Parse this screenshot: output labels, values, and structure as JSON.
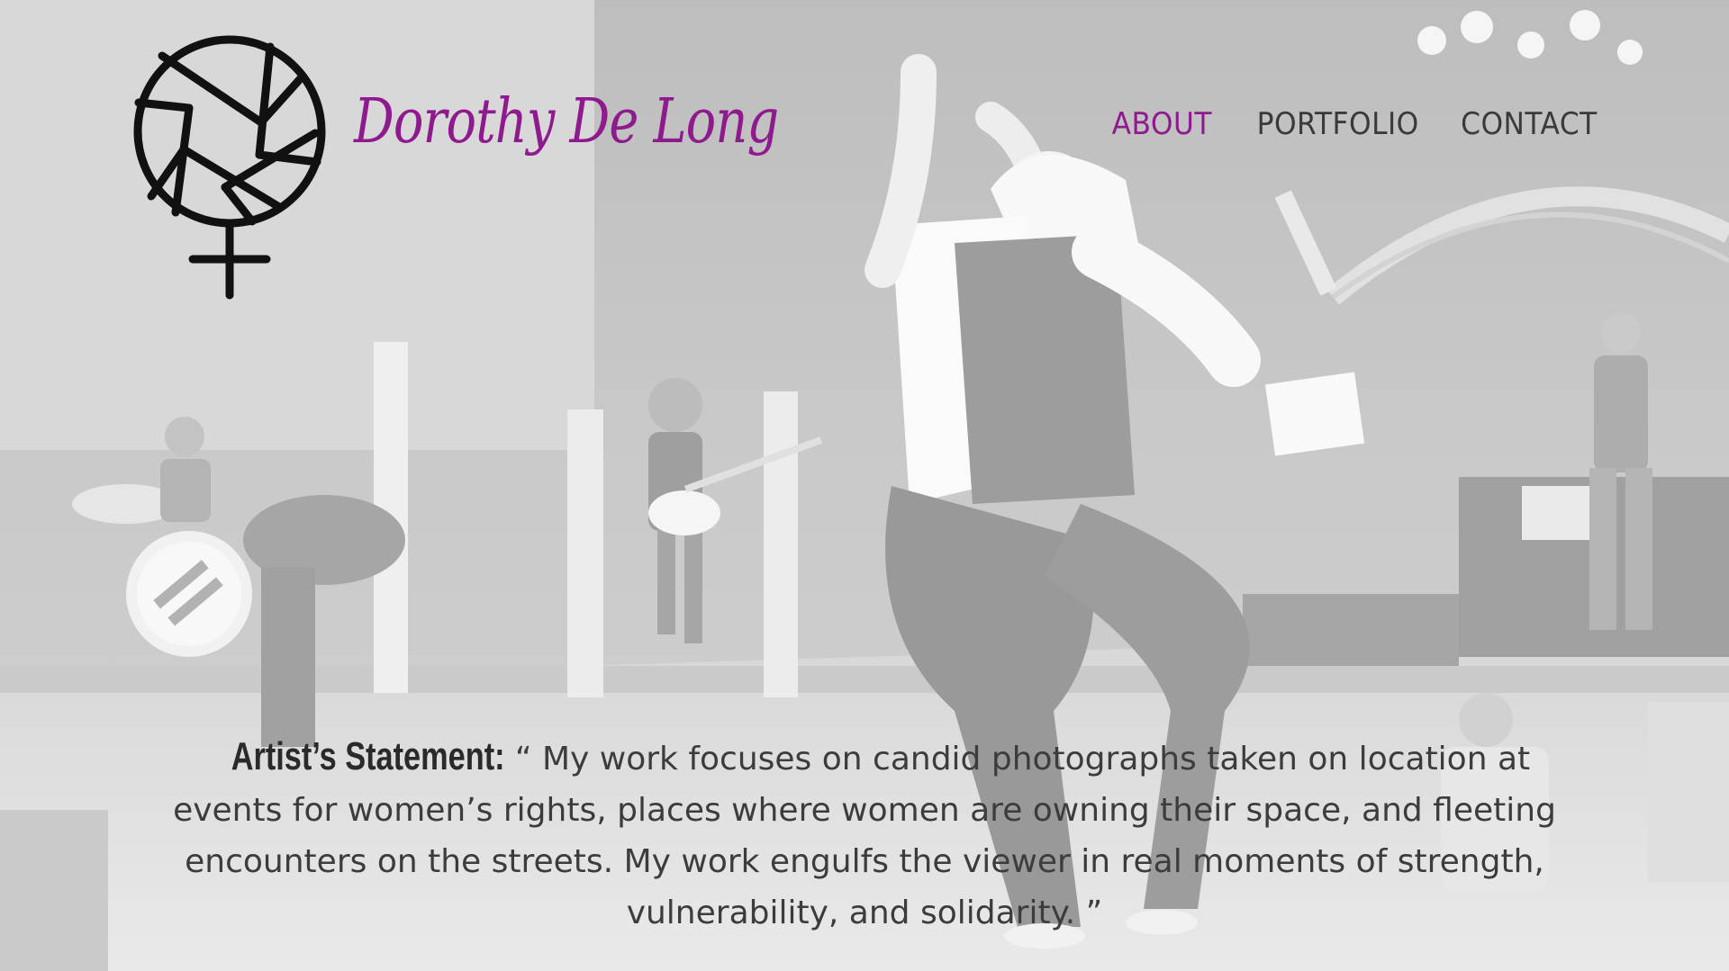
{
  "site": {
    "brand_name": "Dorothy De Long",
    "logo_icon": "aperture-female-symbol-icon"
  },
  "nav": {
    "items": [
      {
        "label": "ABOUT",
        "active": true
      },
      {
        "label": "PORTFOLIO",
        "active": false
      },
      {
        "label": "CONTACT",
        "active": false
      }
    ]
  },
  "statement": {
    "label": "Artist’s Statement:",
    "text": "“ My work focuses on candid photographs taken on location at events for women’s rights, places where women are owning their space, and fleeting encounters on the streets. My work engulfs the viewer in real moments of strength, vulnerability, and solidarity. ”"
  },
  "colors": {
    "accent": "#8e1a8e",
    "text": "#3c3c3c",
    "logo": "#111111"
  }
}
